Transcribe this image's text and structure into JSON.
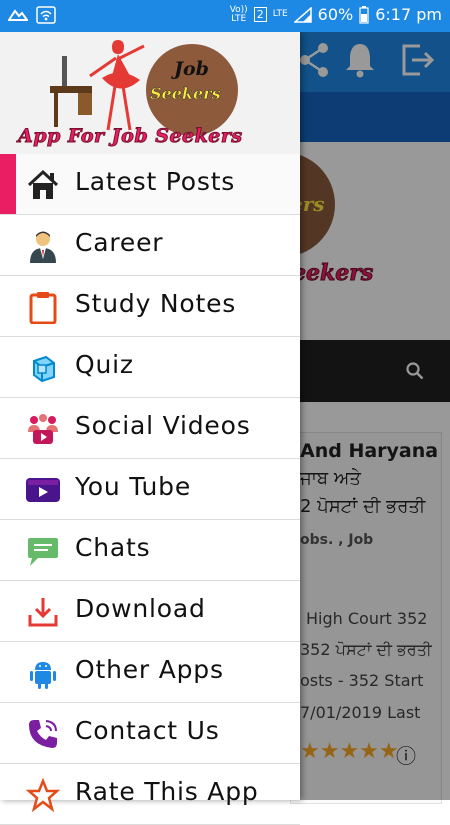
{
  "status_bar": {
    "volte": "Vo)) LTE",
    "sim": "2",
    "lte": "LTE",
    "battery": "60%",
    "time": "6:17 pm"
  },
  "drawer": {
    "header": {
      "logo_line1": "Job",
      "logo_line2": "Seekers",
      "title": "App For Job Seekers"
    },
    "active_item": "Latest Posts",
    "items": [
      {
        "label": "Latest Posts",
        "icon": "home-icon"
      },
      {
        "label": "Career",
        "icon": "businessman-icon"
      },
      {
        "label": "Study Notes",
        "icon": "clipboard-icon"
      },
      {
        "label": "Quiz",
        "icon": "cube-icon"
      },
      {
        "label": "Social Videos",
        "icon": "video-people-icon"
      },
      {
        "label": "You Tube",
        "icon": "youtube-icon"
      },
      {
        "label": "Chats",
        "icon": "chat-icon"
      },
      {
        "label": "Download",
        "icon": "download-icon"
      },
      {
        "label": "Other Apps",
        "icon": "android-icon"
      },
      {
        "label": "Contact Us",
        "icon": "phone-icon"
      },
      {
        "label": "Rate This App",
        "icon": "star-icon"
      }
    ]
  },
  "background": {
    "logo_partial_1": "ers",
    "logo_partial_2": "eekers",
    "post_title_line1": "And Haryana",
    "post_title_line2": "ਜਾਬ ਅਤੇ",
    "post_title_line3": "2 ਪੋਸਟਾਂ ਦੀ ਭਰਤੀ",
    "post_tags": "obs. , Job",
    "post_excerpt_line1": "High Court 352",
    "post_excerpt_line2": "352 ਪੋਸਟਾਂ ਦੀ ਭਰਤੀ",
    "post_excerpt_line3": "osts - 352 Start",
    "post_excerpt_line4": "7/01/2019   Last",
    "rating_stars": "★★★★★",
    "info_glyph": "ⓘ"
  },
  "colors": {
    "primary": "#1e88e5",
    "primary_dark": "#1565c0",
    "accent": "#e91e63"
  }
}
